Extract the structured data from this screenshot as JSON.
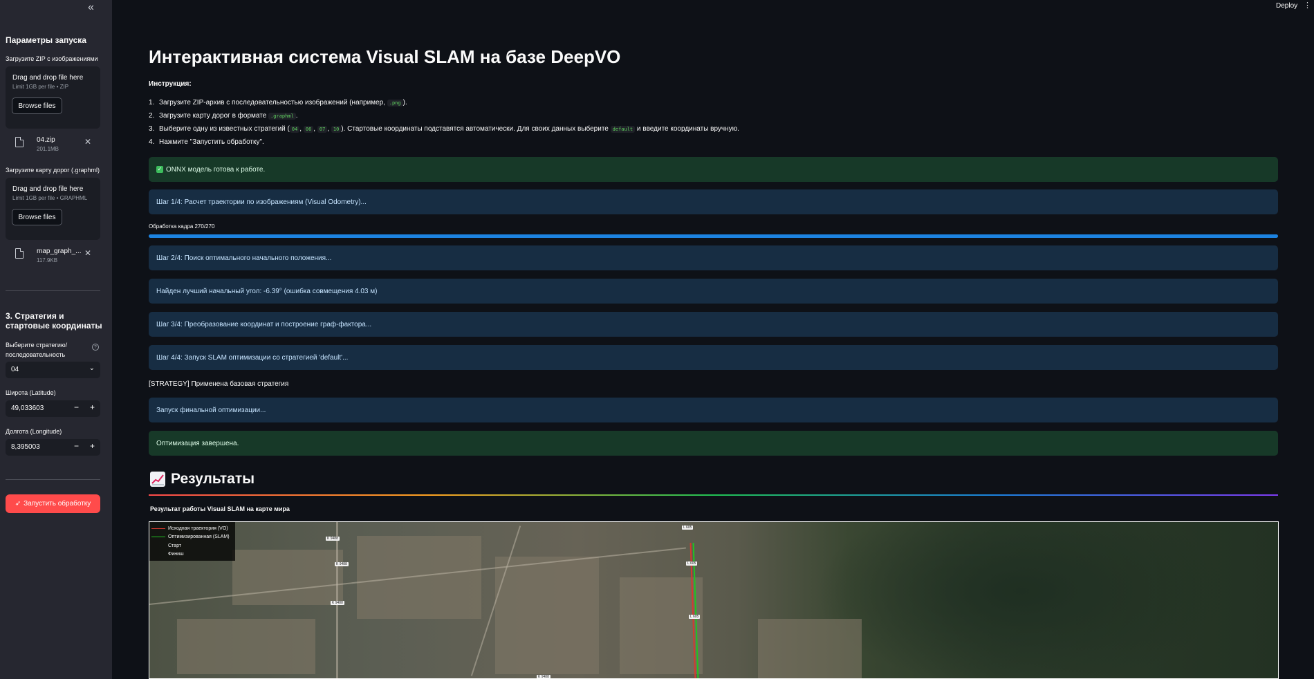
{
  "sidebar": {
    "collapse_icon": "«",
    "title": "Параметры запуска",
    "zip_label": "Загрузите ZIP с изображениями",
    "zip_drop": {
      "title": "Drag and drop file here",
      "limit": "Limit 1GB per file • ZIP",
      "button": "Browse files"
    },
    "zip_file": {
      "name": "04.zip",
      "size": "201.1MB"
    },
    "graphml_label": "Загрузите карту дорог (.graphml)",
    "graphml_drop": {
      "title": "Drag and drop file here",
      "limit": "Limit 1GB per file • GRAPHML",
      "button": "Browse files"
    },
    "graphml_file": {
      "name": "map_graph_...",
      "size": "117.9KB"
    },
    "section3_title": "3. Стратегия и стартовые координаты",
    "strategy_label": "Выберите стратегию/последовательность",
    "strategy_value": "04",
    "lat_label": "Широта (Latitude)",
    "lat_value": "49,033603",
    "lon_label": "Долгота (Longitude)",
    "lon_value": "8,395003",
    "run_button": "Запустить обработку"
  },
  "header": {
    "deploy": "Deploy"
  },
  "main": {
    "title": "Интерактивная система Visual SLAM на базе DeepVO",
    "instructions_heading": "Инструкция:",
    "instructions": [
      {
        "n": "1.",
        "a": "Загрузите ZIP-архив с последовательностью изображений (например, ",
        "code": ".png",
        "b": ")."
      },
      {
        "n": "2.",
        "a": "Загрузите карту дорог в формате ",
        "code": ".graphml",
        "b": "."
      },
      {
        "n": "3.",
        "a": "Выберите одну из известных стратегий (",
        "codes": [
          "04",
          "06",
          "07",
          "10"
        ],
        "b": "). Стартовые координаты подставятся автоматически. Для своих данных выберите ",
        "code2": "default",
        "c": " и введите координаты вручную."
      },
      {
        "n": "4.",
        "a": "Нажмите \"Запустить обработку\".",
        "code": "",
        "b": ""
      }
    ],
    "onnx_ready": "ONNX модель готова к работе.",
    "step1": "Шаг 1/4: Расчет траектории по изображениям (Visual Odometry)...",
    "progress_label": "Обработка кадра 270/270",
    "progress": 1.0,
    "step2": "Шаг 2/4: Поиск оптимального начального положения...",
    "best_angle": "Найден лучший начальный угол: -6.39° (ошибка совмещения 4.03 м)",
    "step3": "Шаг 3/4: Преобразование координат и построение граф-фактора...",
    "step4": "Шаг 4/4: Запуск SLAM оптимизации со стратегией 'default'...",
    "strategy_applied": "[STRATEGY] Применена базовая стратегия",
    "final_opt": "Запуск финальной оптимизации...",
    "opt_done": "Оптимизация завершена.",
    "results_title": "Результаты",
    "map_caption": "Результат работы Visual SLAM на карте мира",
    "legend": {
      "vo": "Исходная траектория (VO)",
      "slam": "Оптимизированная (SLAM)",
      "start": "Старт",
      "finish": "Финиш"
    },
    "road_tags": [
      "K 9488",
      "K 9488",
      "K 9488",
      "L 605",
      "L 605",
      "L 605",
      "K 9488"
    ]
  },
  "colors": {
    "accent": "#ff4b4b",
    "info_bg": "#172d43",
    "success_bg": "#173928",
    "progress": "#1c83e1",
    "vo_line": "#d43a2f",
    "slam_line": "#21c321"
  }
}
